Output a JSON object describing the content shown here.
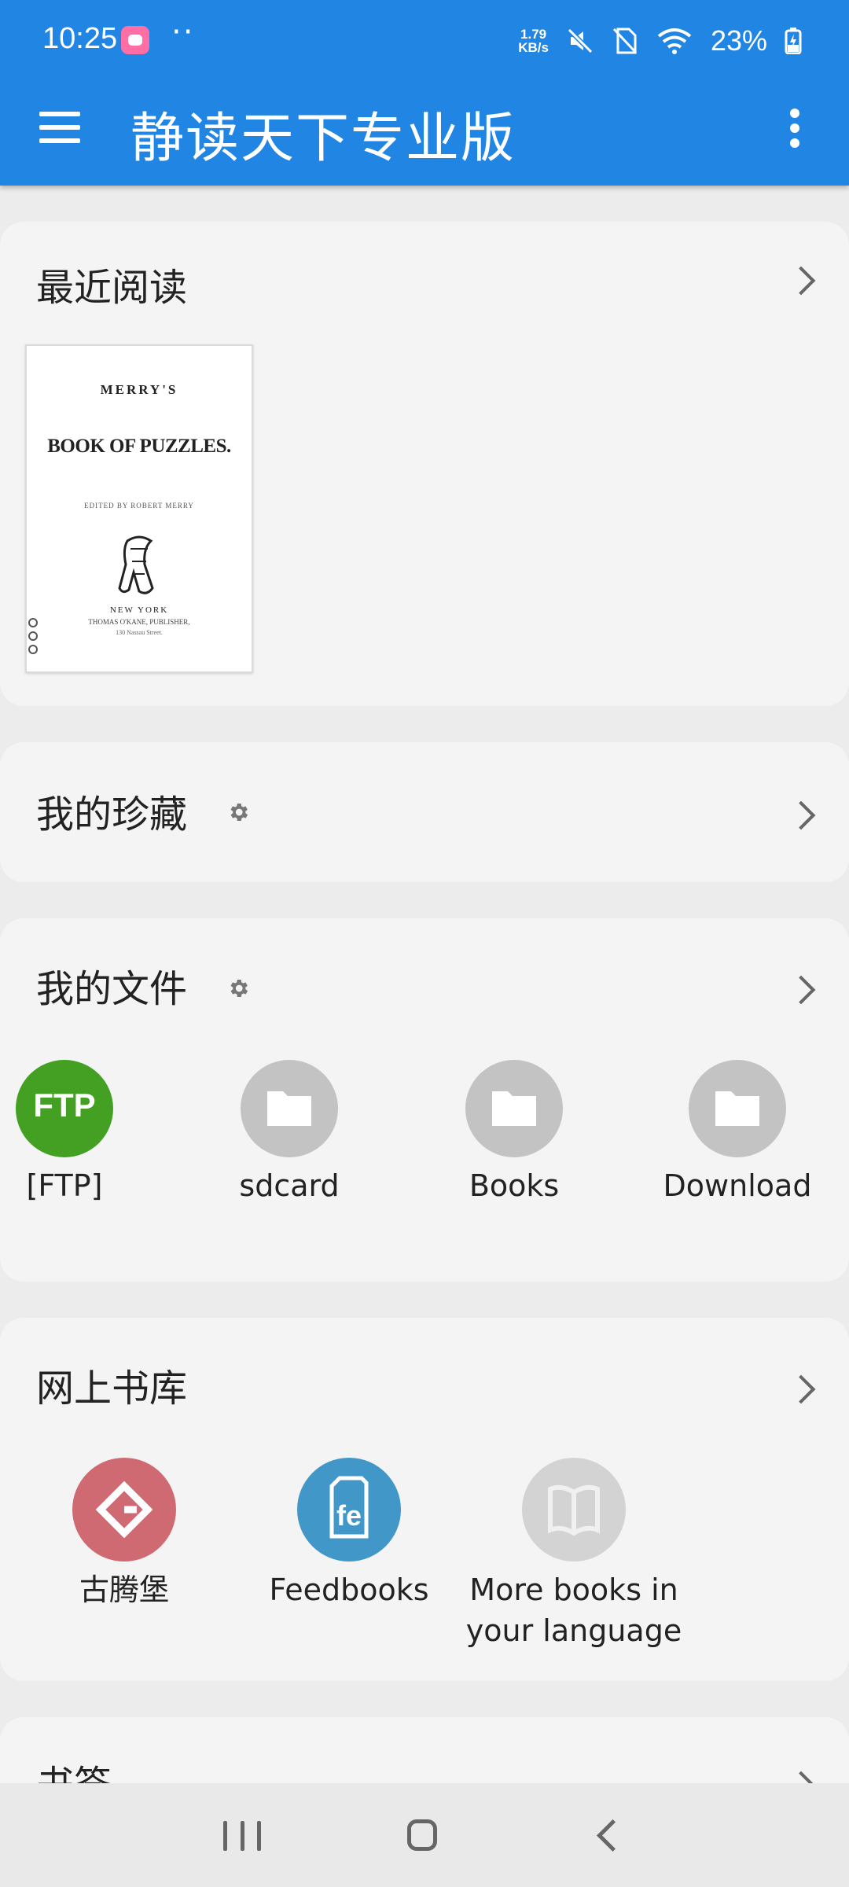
{
  "status_bar": {
    "time": "10:25",
    "dots": "··",
    "net_speed_value": "1.79",
    "net_speed_unit": "KB/s",
    "battery": "23%"
  },
  "app_bar": {
    "title": "静读天下专业版"
  },
  "recent": {
    "title": "最近阅读",
    "book": {
      "cover_line1": "MERRY'S",
      "cover_line2": "BOOK OF PUZZLES.",
      "cover_line3": "EDITED BY ROBERT MERRY",
      "cover_line4": "NEW YORK",
      "cover_line5": "THOMAS O'KANE, PUBLISHER,",
      "cover_line6": "130 Nassau Street."
    }
  },
  "favorites": {
    "title": "我的珍藏"
  },
  "files": {
    "title": "我的文件",
    "items": [
      {
        "label": "[FTP]",
        "badge": "FTP"
      },
      {
        "label": "sdcard"
      },
      {
        "label": "Books"
      },
      {
        "label": "Download"
      }
    ]
  },
  "library": {
    "title": "网上书库",
    "items": [
      {
        "label": "古腾堡"
      },
      {
        "label": "Feedbooks"
      },
      {
        "label": "More books in your language"
      }
    ]
  },
  "bookmarks": {
    "title": "书签"
  },
  "colors": {
    "app_bar": "#2185e3",
    "ftp": "#43a022",
    "gutenberg": "#cf6a73",
    "feedbooks": "#4198c8"
  }
}
